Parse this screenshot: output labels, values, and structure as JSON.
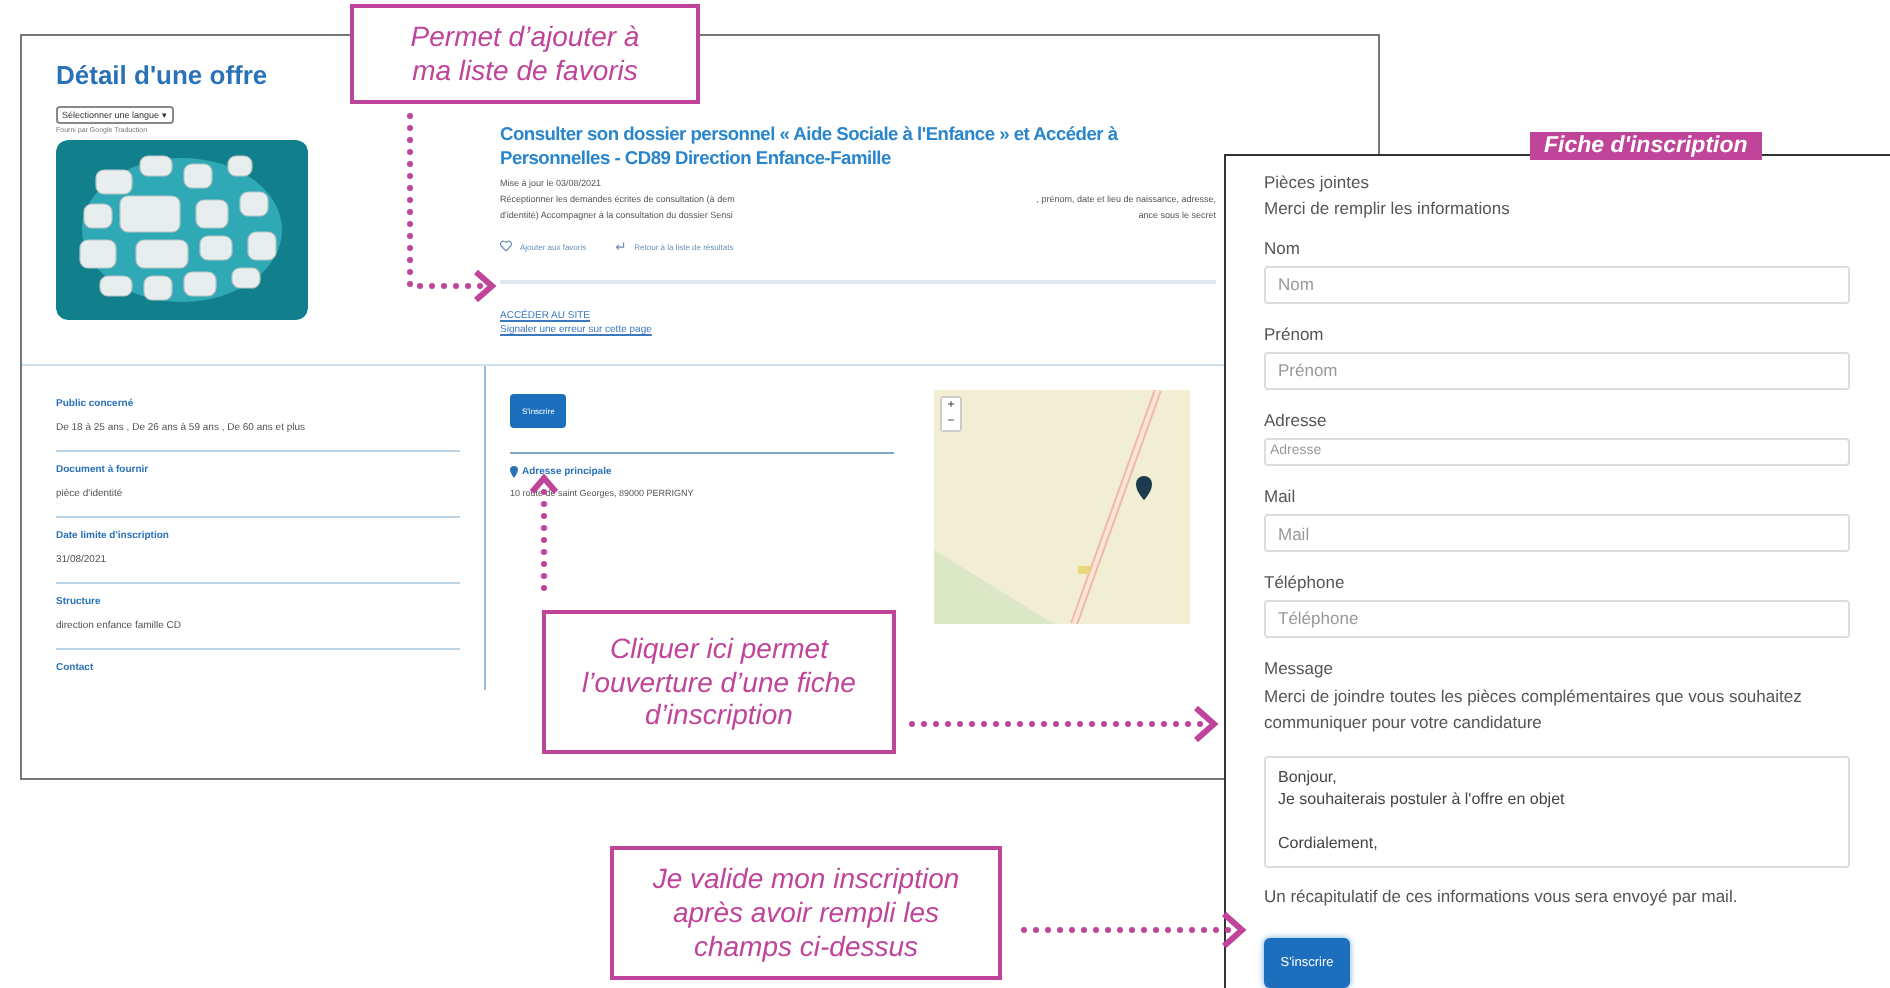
{
  "page": {
    "title": "Détail d'une offre",
    "language_select": "Sélectionner une langue ▾",
    "translate_credit": "Fourni par Google Traduction",
    "offer": {
      "title": "Consulter son dossier personnel « Aide Sociale à l'Enfance » et Accéder à Personnelles - CD89 Direction Enfance-Famille",
      "updated": "Mise à jour le 03/08/2021",
      "description": [
        {
          "left": "Réceptionner les demandes écrites de consultation (à dem",
          "right": ", prénom, date et lieu de naissance, adresse,"
        },
        {
          "left": "d'identité) Accompagner à la consultation du dossier Sensi",
          "right": "ance sous le secret"
        }
      ],
      "actions": [
        {
          "kind": "favorite",
          "label": "Ajouter aux favoris"
        },
        {
          "kind": "back",
          "label": "Retour à la liste de résultats"
        }
      ],
      "links": [
        "ACCÉDER AU SITE",
        "Signaler une erreur sur cette page"
      ]
    },
    "details": [
      {
        "label": "Public concerné",
        "value": "De 18 à 25 ans , De 26 ans à 59 ans , De 60 ans et plus"
      },
      {
        "label": "Document à fournir",
        "value": "pièce d'identité"
      },
      {
        "label": "Date limite d'inscription",
        "value": "31/08/2021"
      },
      {
        "label": "Structure",
        "value": "direction enfance famille CD"
      },
      {
        "label": "Contact"
      }
    ],
    "register_button": "S'inscrire",
    "address": {
      "label": "Adresse principale",
      "value": "10 route de saint Georges, 89000 PERRIGNY"
    },
    "map": {
      "kind": "picture",
      "zoom_in": "+",
      "zoom_out": "−"
    }
  },
  "form": {
    "tag": "Fiche d'inscription",
    "attachments_label": "Pièces jointes",
    "intro": "Merci de remplir les informations",
    "fields": [
      {
        "label": "Nom",
        "placeholder": "Nom",
        "kind": "input"
      },
      {
        "label": "Prénom",
        "placeholder": "Prénom",
        "kind": "input"
      },
      {
        "label": "Adresse",
        "placeholder": "Adresse",
        "kind": "compact"
      },
      {
        "label": "Mail",
        "placeholder": "Mail",
        "kind": "input"
      },
      {
        "label": "Téléphone",
        "placeholder": "Téléphone",
        "kind": "input"
      }
    ],
    "message": {
      "label": "Message",
      "hint": "Merci de joindre toutes les pièces complémentaires que vous souhaitez communiquer pour votre candidature",
      "value": "Bonjour,\nJe souhaiterais postuler à l'offre en objet\n\nCordialement,"
    },
    "note": "Un récapitulatif de ces informations vous sera envoyé par mail.",
    "submit": "S'inscrire"
  },
  "annotations": [
    {
      "text": "Permet d’ajouter à ma liste de favoris"
    },
    {
      "text": "Cliquer ici permet l’ouverture d’une fiche d’inscription"
    },
    {
      "text": "Je valide mon inscription après avoir rempli les champs ci-dessus"
    }
  ]
}
